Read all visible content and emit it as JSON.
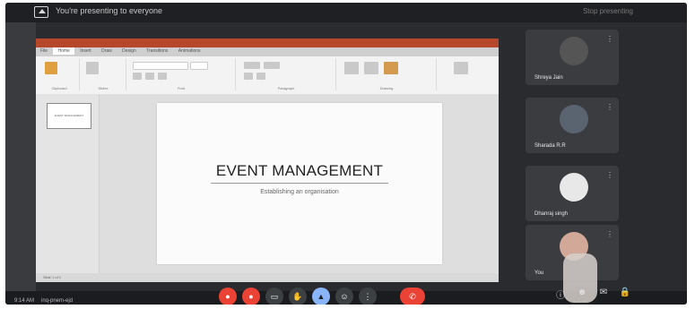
{
  "meet": {
    "banner_text": "You're presenting to everyone",
    "stop_text": "Stop presenting",
    "time": "9:14 AM",
    "meeting_code": "inq-pnem-ejd"
  },
  "ppt": {
    "tabs": [
      "File",
      "Home",
      "Insert",
      "Draw",
      "Design",
      "Transitions",
      "Animations"
    ],
    "active_tab": "Home",
    "ribbon_groups": [
      "Clipboard",
      "Slides",
      "Font",
      "Paragraph",
      "Drawing"
    ],
    "ribbon_buttons": {
      "shapes": "Shapes",
      "arrange": "Arrange",
      "quick_styles": "Quick Styles",
      "design_ideas": "Design Ideas"
    },
    "thumbnail_text": "EVENT MANAGEMENT",
    "slide": {
      "title": "EVENT MANAGEMENT",
      "subtitle": "Establishing an organisation"
    },
    "status": "Slide 1 of 1"
  },
  "participants": [
    {
      "name": "Shreya Jain"
    },
    {
      "name": "Sharada R.R"
    },
    {
      "name": "Dhanraj singh"
    },
    {
      "name": "You"
    }
  ],
  "controls": [
    "mic",
    "camera",
    "captions",
    "hand",
    "present",
    "more",
    "options",
    "end"
  ],
  "colors": {
    "ppt_accent": "#b7472a",
    "end_call": "#ea4335",
    "present_active": "#8ab4f8"
  }
}
